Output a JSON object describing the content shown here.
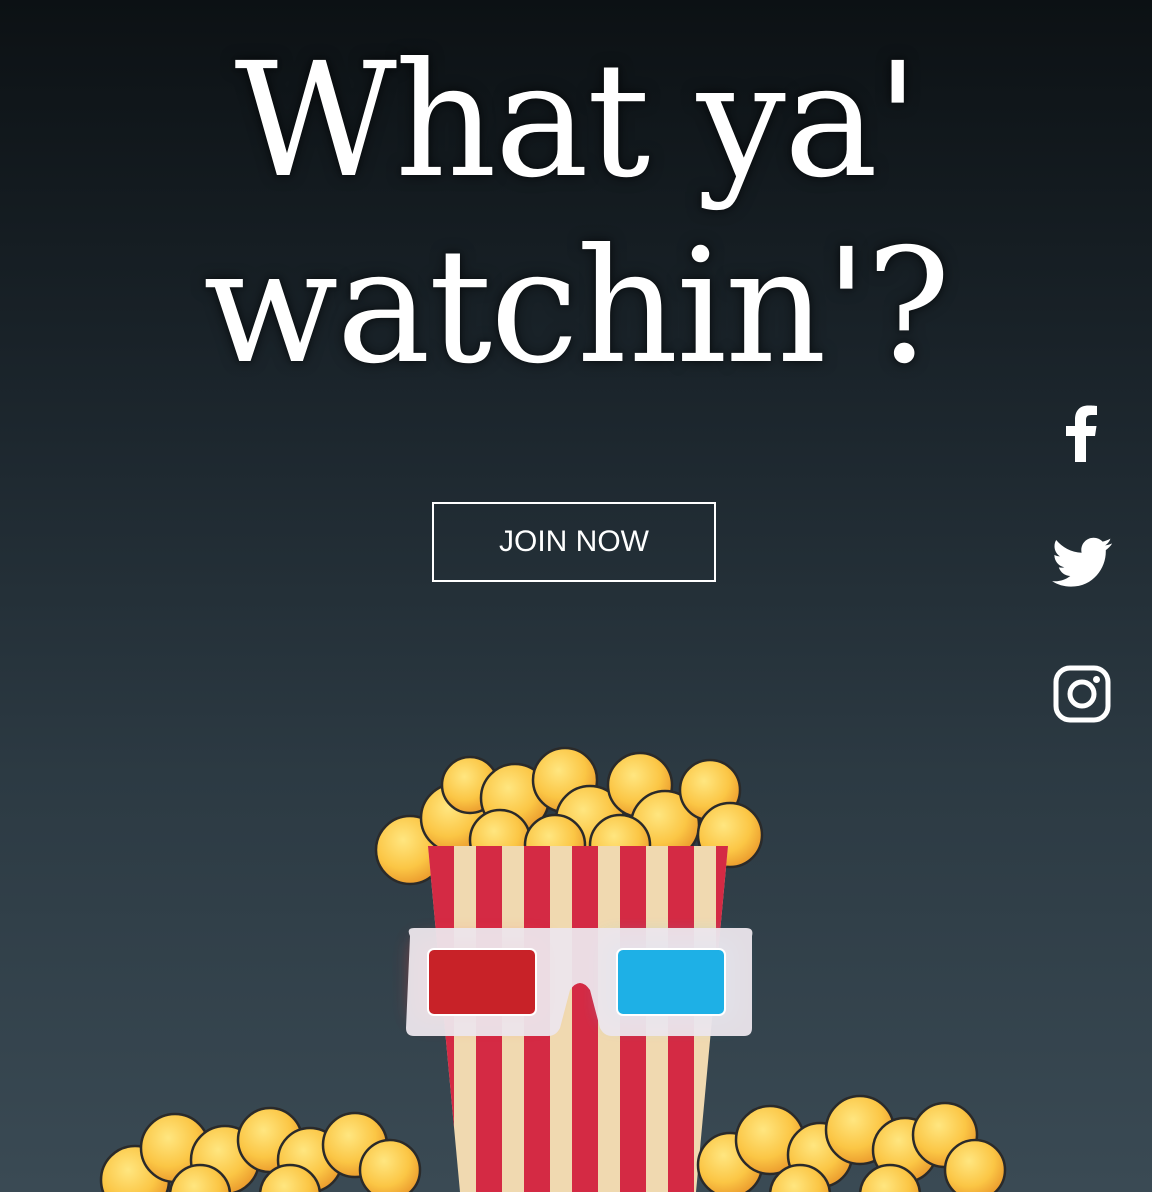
{
  "hero": {
    "headline_line1": "What ya'",
    "headline_line2": "watchin'?",
    "cta_label": "JOIN NOW"
  },
  "social": [
    {
      "name": "facebook",
      "icon": "facebook-icon"
    },
    {
      "name": "twitter",
      "icon": "twitter-icon"
    },
    {
      "name": "instagram",
      "icon": "instagram-icon"
    }
  ],
  "illustration": {
    "description_icon": "popcorn-with-3d-glasses",
    "colors": {
      "stripe_red": "#d42a44",
      "stripe_cream": "#f0d9b0",
      "popcorn": "#f9c545",
      "lens_red": "#c82228",
      "lens_blue": "#1eb0e6",
      "frame": "#e9e4ea"
    }
  }
}
